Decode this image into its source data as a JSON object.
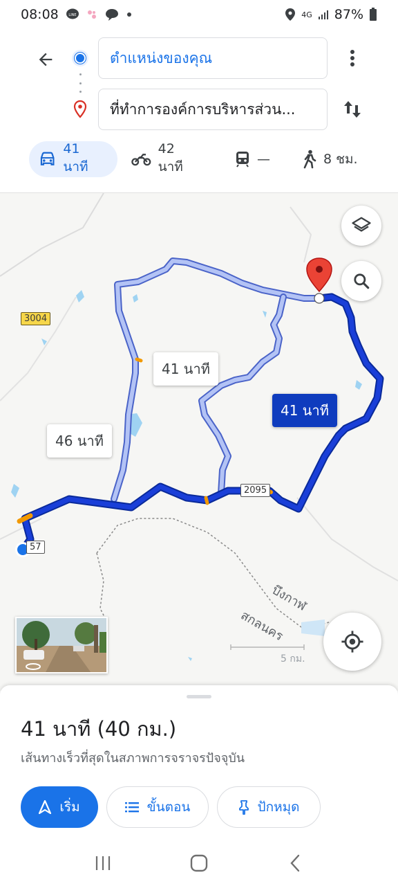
{
  "status_bar": {
    "time": "08:08",
    "battery": "87%",
    "network": "4G"
  },
  "directions": {
    "origin": "ตำแหน่งของคุณ",
    "destination": "ที่ทำการองค์การบริหารส่วน..."
  },
  "modes": [
    {
      "name": "car",
      "label": "41 นาที",
      "active": true
    },
    {
      "name": "motorcycle",
      "label": "42 นาที",
      "active": false
    },
    {
      "name": "transit",
      "label": "—",
      "active": false
    },
    {
      "name": "walk",
      "label": "8 ชม.",
      "active": false
    }
  ],
  "map": {
    "route_labels": {
      "primary": "41 นาที",
      "alt1": "41 นาที",
      "alt2": "46 นาที"
    },
    "road_shields": {
      "r3004": "3004",
      "r2095": "2095",
      "r57": "57"
    },
    "place_labels": {
      "bueng_kan": "บึงกาฬ",
      "sakon_nakhon": "สกลนคร",
      "scale": "5 กม."
    },
    "colors": {
      "route_primary": "#1a3fd8",
      "route_alt": "#a8b8f0",
      "pin": "#ea4335"
    }
  },
  "sheet": {
    "summary": "41 นาที (40 กม.)",
    "subtitle": "เส้นทางเร็วที่สุดในสภาพการจราจรปัจจุบัน",
    "buttons": {
      "start": "เริ่ม",
      "steps": "ขั้นตอน",
      "pin": "ปักหมุด"
    }
  }
}
